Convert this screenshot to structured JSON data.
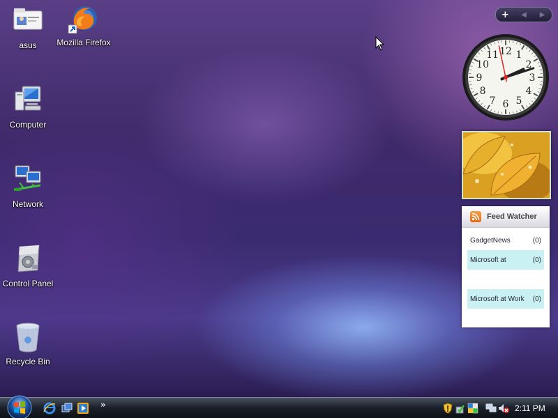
{
  "desktop": {
    "icons": [
      {
        "label": "asus",
        "icon": "user-folder-icon"
      },
      {
        "label": "Mozilla Firefox",
        "icon": "firefox-icon"
      },
      {
        "label": "Computer",
        "icon": "computer-icon"
      },
      {
        "label": "Network",
        "icon": "network-icon"
      },
      {
        "label": "Control Panel",
        "icon": "control-panel-icon"
      },
      {
        "label": "Recycle Bin",
        "icon": "recycle-bin-icon"
      }
    ]
  },
  "sidebar": {
    "controls": {
      "add": "+",
      "prev": "◀",
      "next": "▶"
    },
    "clock": {
      "numbers": [
        "12",
        "1",
        "2",
        "3",
        "4",
        "5",
        "6",
        "7",
        "8",
        "9",
        "10",
        "11"
      ],
      "hour": 2,
      "minute": 11,
      "second": 58
    },
    "slideshow": {
      "icon": "slideshow-picture-icon"
    },
    "feed_watcher": {
      "title": "Feed Watcher",
      "feeds": [
        {
          "name": "GadgetNews",
          "count": "(0)",
          "highlighted": false
        },
        {
          "name": "Microsoft at",
          "count": "(0)",
          "highlighted": true
        },
        {
          "name": "",
          "count": "",
          "highlighted": false
        },
        {
          "name": "Microsoft at Work",
          "count": "(0)",
          "highlighted": true
        }
      ]
    }
  },
  "taskbar": {
    "start_icon": "windows-orb-icon",
    "quick_launch": [
      "internet-explorer-icon",
      "switch-windows-icon",
      "media-player-icon"
    ],
    "overflow": "»",
    "tray_icons": [
      "security-shield-icon",
      "windows-defender-icon",
      "network-tray-icon",
      "volume-muted-icon"
    ],
    "time": "2:11 PM"
  },
  "colors": {
    "feed_highlight": "#c9f1f4",
    "taskbar": "#1c222c"
  }
}
